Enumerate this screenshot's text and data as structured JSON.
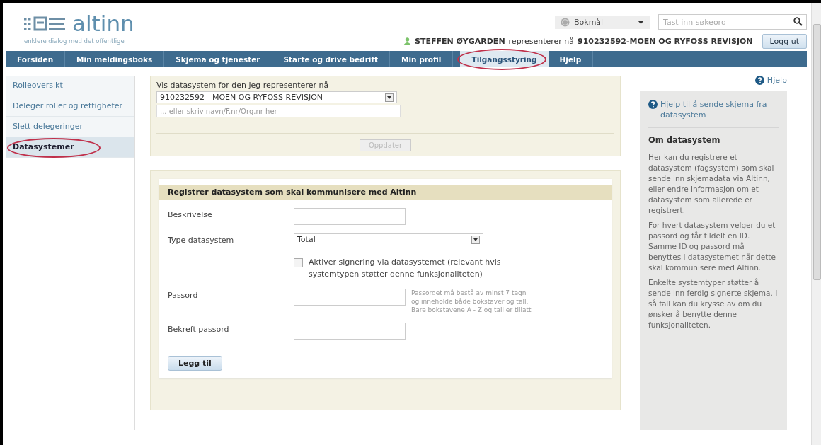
{
  "header": {
    "logo": "altinn",
    "tagline": "enklere dialog med det offentlige",
    "language": "Bokmål",
    "search": {
      "placeholder": "Tast inn søkeord"
    },
    "user": "STEFFEN ØYGARDEN",
    "represents_text": "representerer nå",
    "organization": "910232592-MOEN OG RYFOSS REVISJON",
    "logout": "Logg ut"
  },
  "nav": [
    {
      "label": "Forsiden",
      "selected": false,
      "circled": false
    },
    {
      "label": "Min meldingsboks",
      "selected": false,
      "circled": false
    },
    {
      "label": "Skjema og tjenester",
      "selected": false,
      "circled": false
    },
    {
      "label": "Starte og drive bedrift",
      "selected": false,
      "circled": false
    },
    {
      "label": "Min profil",
      "selected": false,
      "circled": false
    },
    {
      "label": "Tilgangsstyring",
      "selected": true,
      "circled": true
    },
    {
      "label": "Hjelp",
      "selected": false,
      "circled": false
    }
  ],
  "sidebar": {
    "items": [
      {
        "label": "Rolleoversikt",
        "selected": false,
        "circled": false
      },
      {
        "label": "Deleger roller og rettigheter",
        "selected": false,
        "circled": false
      },
      {
        "label": "Slett delegeringer",
        "selected": false,
        "circled": false
      },
      {
        "label": "Datasystemer",
        "selected": true,
        "circled": true
      }
    ]
  },
  "selector": {
    "label": "Vis datasystem for den jeg representerer nå",
    "value": "910232592 - MOEN OG RYFOSS REVISJON",
    "search_placeholder": "... eller skriv navn/F.nr/Org.nr her",
    "update_button": "Oppdater",
    "update_disabled": true
  },
  "form": {
    "title": "Registrer datasystem som skal kommunisere med Altinn",
    "fields": [
      {
        "kind": "text",
        "label": "Beskrivelse"
      },
      {
        "kind": "select",
        "label": "Type datasystem",
        "value": "Total"
      },
      {
        "kind": "checkbox",
        "label": "Aktiver signering via datasystemet (relevant hvis systemtypen støtter denne funksjonaliteten)",
        "checked": false
      },
      {
        "kind": "password",
        "label": "Passord",
        "hint": "Passordet må bestå av minst 7 tegn og inneholde både bokstaver og tall. Bare bokstavene A - Z og tall er tillatt"
      },
      {
        "kind": "password",
        "label": "Bekreft passord"
      }
    ],
    "submit": "Legg til"
  },
  "help": {
    "top_link": "Hjelp",
    "link": "Hjelp til å sende skjema fra datasystem",
    "heading": "Om datasystem",
    "paragraphs": [
      "Her kan du registrere et datasystem (fagsystem) som skal sende inn skjemadata via Altinn, eller endre informasjon om et datasystem som allerede er registrert.",
      "For hvert datasystem velger du et passord og får tildelt en ID. Samme ID og passord må benyttes i datasystemet når dette skal kommunisere med Altinn.",
      "Enkelte systemtyper støtter å sende inn ferdig signerte skjema. I så fall kan du krysse av om du ønsker å benytte denne funksjonaliteten."
    ]
  }
}
